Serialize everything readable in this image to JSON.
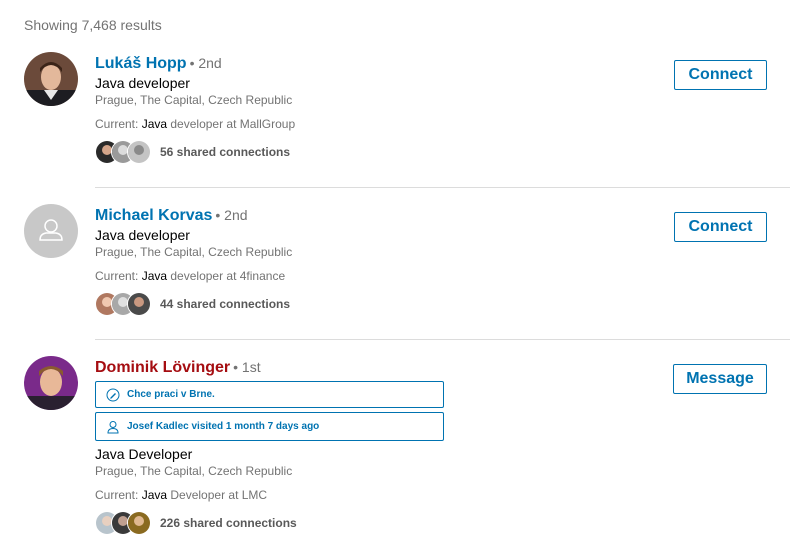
{
  "results_count": "Showing 7,468 results",
  "results": [
    {
      "name": "Lukáš Hopp",
      "degree": "• 2nd",
      "headline": "Java developer",
      "location": "Prague, The Capital, Czech Republic",
      "current_prefix": "Current: ",
      "current_keyword": "Java",
      "current_rest": " developer at MallGroup",
      "shared_connections": "56 shared connections",
      "action": "Connect"
    },
    {
      "name": "Michael Korvas",
      "degree": "• 2nd",
      "headline": "Java developer",
      "location": "Prague, The Capital, Czech Republic",
      "current_prefix": "Current: ",
      "current_keyword": "Java",
      "current_rest": " developer at 4finance",
      "shared_connections": "44 shared connections",
      "action": "Connect"
    },
    {
      "name": "Dominik Lövinger",
      "degree": "• 1st",
      "note": "Chce praci v Brne.",
      "visit": "Josef Kadlec visited 1 month 7 days ago",
      "headline": "Java Developer",
      "location": "Prague, The Capital, Czech Republic",
      "current_prefix": "Current: ",
      "current_keyword": "Java",
      "current_rest": " Developer at LMC",
      "shared_connections": "226 shared connections",
      "action": "Message"
    }
  ],
  "colors": {
    "link_blue": "#0073b1",
    "name_red": "#a50d11",
    "muted_text": "#737373"
  },
  "icons": [
    "person-placeholder-icon",
    "pencil-icon",
    "person-outline-icon"
  ]
}
